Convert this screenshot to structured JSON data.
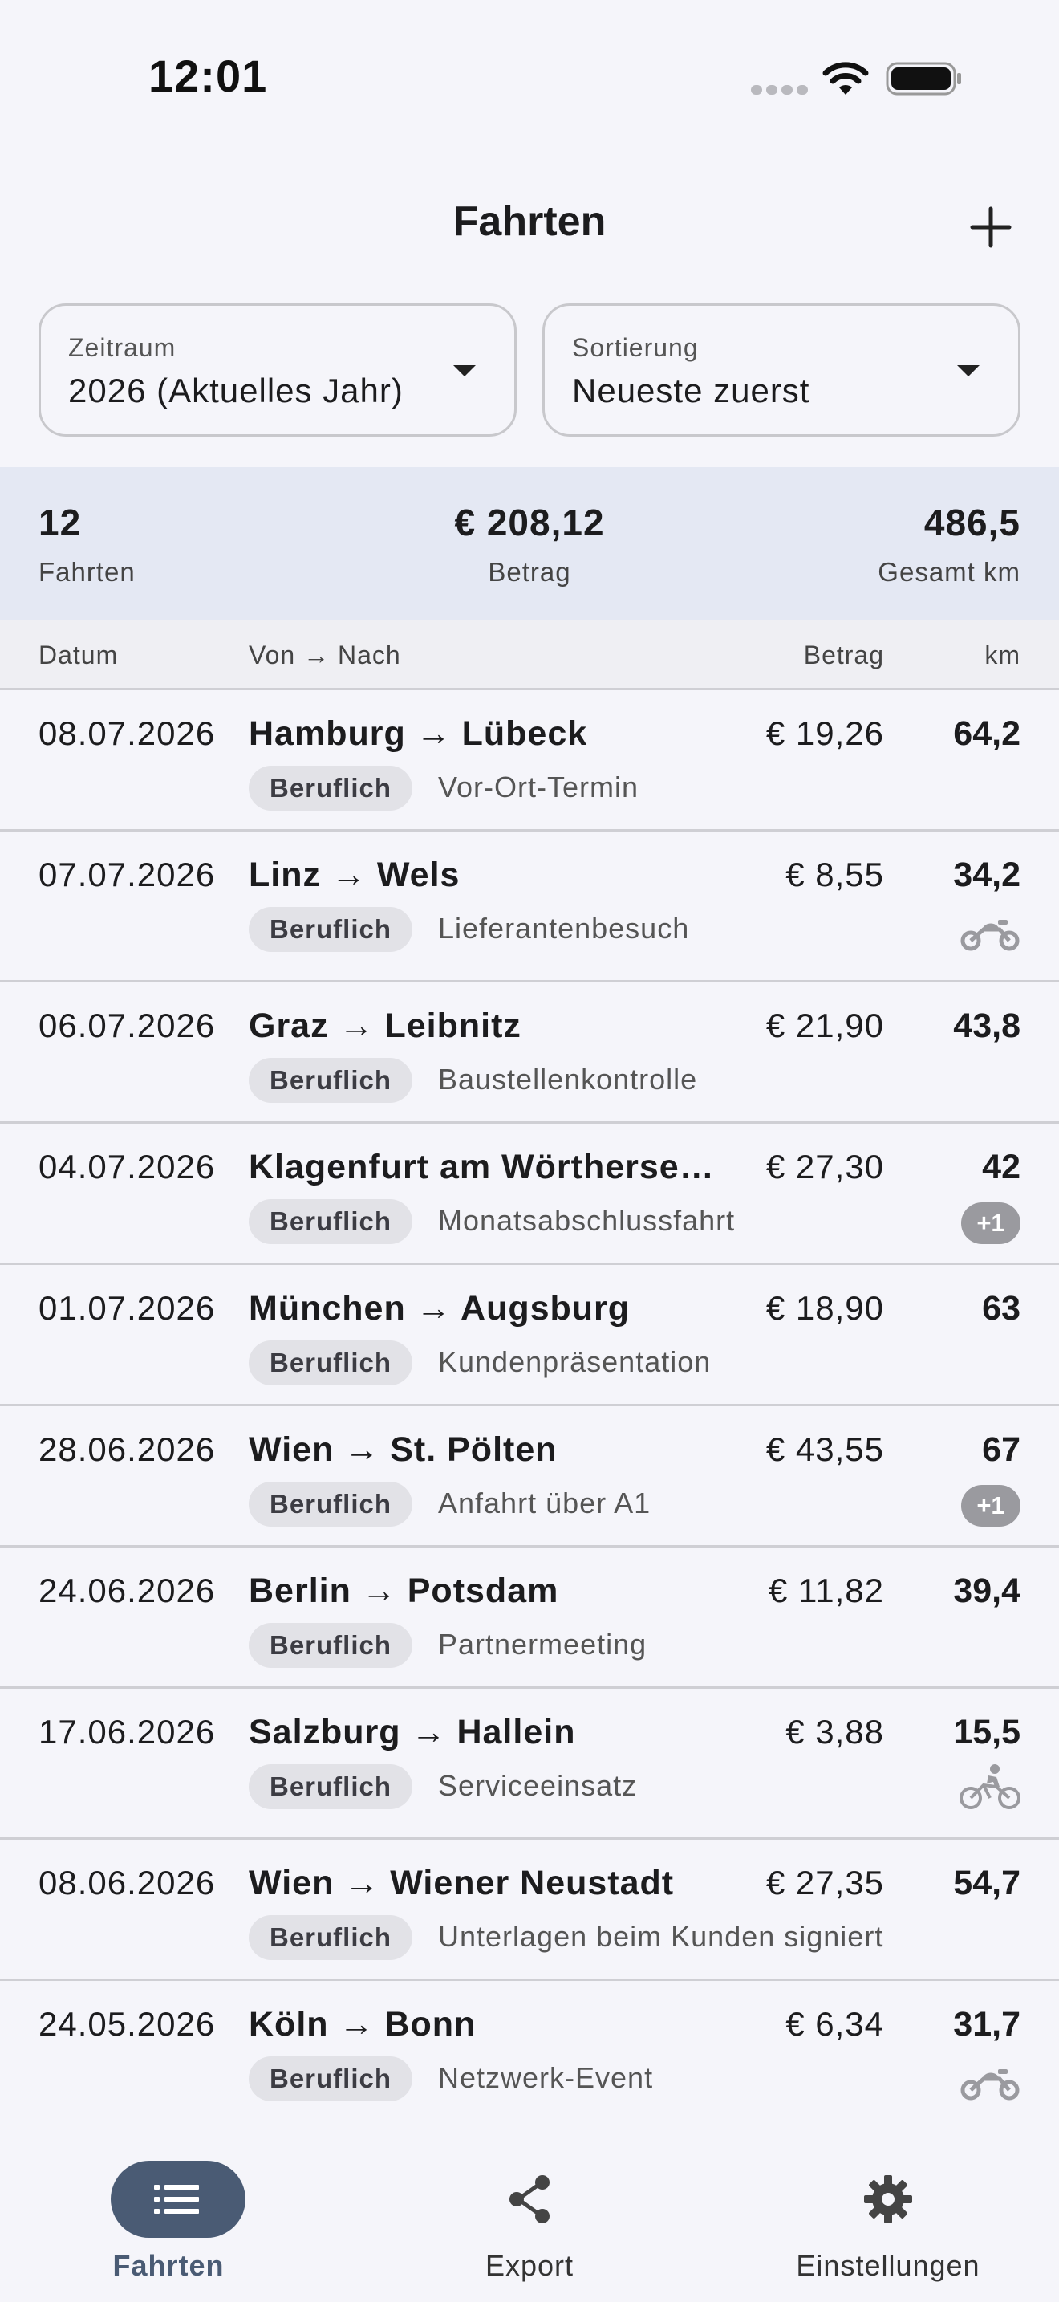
{
  "status_bar": {
    "time": "12:01"
  },
  "header": {
    "title": "Fahrten",
    "add_icon": "plus-icon"
  },
  "filters": {
    "period": {
      "label": "Zeitraum",
      "value": "2026 (Aktuelles Jahr)"
    },
    "sort": {
      "label": "Sortierung",
      "value": "Neueste zuerst"
    }
  },
  "summary": {
    "trips_value": "12",
    "trips_label": "Fahrten",
    "amount_value": "€ 208,12",
    "amount_label": "Betrag",
    "km_value": "486,5",
    "km_label": "Gesamt km"
  },
  "table": {
    "headers": {
      "date": "Datum",
      "route": "Von → Nach",
      "amount": "Betrag",
      "km": "km"
    },
    "rows": [
      {
        "date": "08.07.2026",
        "route": "Hamburg → Lübeck",
        "amount": "€ 19,26",
        "km": "64,2",
        "tag": "Beruflich",
        "note": "Vor-Ort-Termin",
        "extra": ""
      },
      {
        "date": "07.07.2026",
        "route": "Linz → Wels",
        "amount": "€ 8,55",
        "km": "34,2",
        "tag": "Beruflich",
        "note": "Lieferantenbesuch",
        "extra": "motorcycle-icon"
      },
      {
        "date": "06.07.2026",
        "route": "Graz → Leibnitz",
        "amount": "€ 21,90",
        "km": "43,8",
        "tag": "Beruflich",
        "note": "Baustellenkontrolle",
        "extra": ""
      },
      {
        "date": "04.07.2026",
        "route": "Klagenfurt am Wörtherse…",
        "amount": "€ 27,30",
        "km": "42",
        "tag": "Beruflich",
        "note": "Monatsabschlussfahrt",
        "extra": "+1"
      },
      {
        "date": "01.07.2026",
        "route": "München → Augsburg",
        "amount": "€ 18,90",
        "km": "63",
        "tag": "Beruflich",
        "note": "Kundenpräsentation",
        "extra": ""
      },
      {
        "date": "28.06.2026",
        "route": "Wien → St. Pölten",
        "amount": "€ 43,55",
        "km": "67",
        "tag": "Beruflich",
        "note": "Anfahrt über A1",
        "extra": "+1"
      },
      {
        "date": "24.06.2026",
        "route": "Berlin → Potsdam",
        "amount": "€ 11,82",
        "km": "39,4",
        "tag": "Beruflich",
        "note": "Partnermeeting",
        "extra": ""
      },
      {
        "date": "17.06.2026",
        "route": "Salzburg → Hallein",
        "amount": "€ 3,88",
        "km": "15,5",
        "tag": "Beruflich",
        "note": "Serviceeinsatz",
        "extra": "bicycle-icon"
      },
      {
        "date": "08.06.2026",
        "route": "Wien → Wiener Neustadt",
        "amount": "€ 27,35",
        "km": "54,7",
        "tag": "Beruflich",
        "note": "Unterlagen beim Kunden signiert",
        "extra": ""
      },
      {
        "date": "24.05.2026",
        "route": "Köln → Bonn",
        "amount": "€ 6,34",
        "km": "31,7",
        "tag": "Beruflich",
        "note": "Netzwerk-Event",
        "extra": "motorcycle-icon"
      }
    ]
  },
  "bottom_nav": {
    "items": [
      {
        "label": "Fahrten",
        "icon": "list-icon",
        "active": true
      },
      {
        "label": "Export",
        "icon": "share-icon",
        "active": false
      },
      {
        "label": "Einstellungen",
        "icon": "gear-icon",
        "active": false
      }
    ]
  },
  "colors": {
    "accent": "#4a5b74",
    "summary_bg": "#e4e8f3",
    "background": "#f5f5fa",
    "tag_bg": "#e2e2e7",
    "badge_bg": "#9a9a9f"
  }
}
